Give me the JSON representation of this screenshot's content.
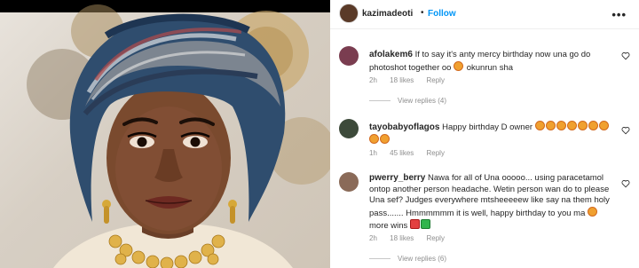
{
  "post": {
    "username": "kazimadeoti",
    "follow_label": "Follow",
    "more_icon": "more-dots-icon"
  },
  "comments": [
    {
      "username": "afolakem6",
      "text": "If to say it's anty mercy birthday now una go do photoshot together oo",
      "text_tail": "okunrun sha",
      "time": "2h",
      "likes": "18 likes",
      "reply_label": "Reply",
      "view_replies": "View replies (4)"
    },
    {
      "username": "tayobabyoflagos",
      "text": "Happy birthday D owner",
      "time": "1h",
      "likes": "45 likes",
      "reply_label": "Reply"
    },
    {
      "username": "pwerry_berry",
      "text": "Nawa for all of Una ooooo... using paracetamol ontop another person headache. Wetin person wan do to please Una sef? Judges everywhere mtsheeeeew like say na them holy pass....... Hmmmmmm it is well, happy birthday to you ma",
      "text_tail": "more wins",
      "time": "2h",
      "likes": "18 likes",
      "reply_label": "Reply",
      "view_replies": "View replies (6)"
    }
  ],
  "colors": {
    "link_blue": "#0095f6",
    "meta_gray": "#8e8e8e"
  }
}
